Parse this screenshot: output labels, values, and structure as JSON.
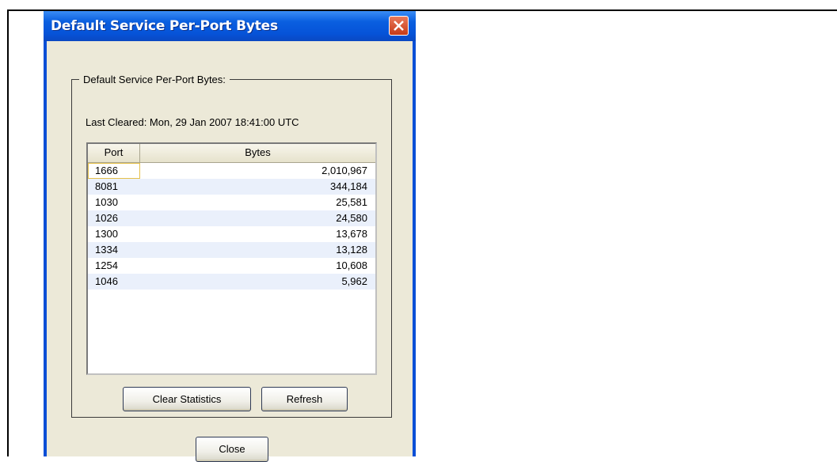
{
  "window": {
    "title": "Default Service Per-Port Bytes"
  },
  "group": {
    "legend": "Default Service Per-Port Bytes:",
    "last_cleared": "Last Cleared: Mon, 29 Jan 2007 18:41:00 UTC"
  },
  "table": {
    "columns": [
      "Port",
      "Bytes"
    ],
    "rows": [
      {
        "port": "1666",
        "bytes": "2,010,967"
      },
      {
        "port": "8081",
        "bytes": "344,184"
      },
      {
        "port": "1030",
        "bytes": "25,581"
      },
      {
        "port": "1026",
        "bytes": "24,580"
      },
      {
        "port": "1300",
        "bytes": "13,678"
      },
      {
        "port": "1334",
        "bytes": "13,128"
      },
      {
        "port": "1254",
        "bytes": "10,608"
      },
      {
        "port": "1046",
        "bytes": "5,962"
      }
    ],
    "selected_row": 0
  },
  "buttons": {
    "clear_statistics": "Clear Statistics",
    "refresh": "Refresh",
    "close": "Close"
  },
  "colors": {
    "titlebar": "#0a5fe0",
    "window_bg": "#ece9d8",
    "alt_row": "#eaf0fb",
    "close_button": "#c73a17"
  },
  "icons": {
    "title_close": "close-icon"
  }
}
